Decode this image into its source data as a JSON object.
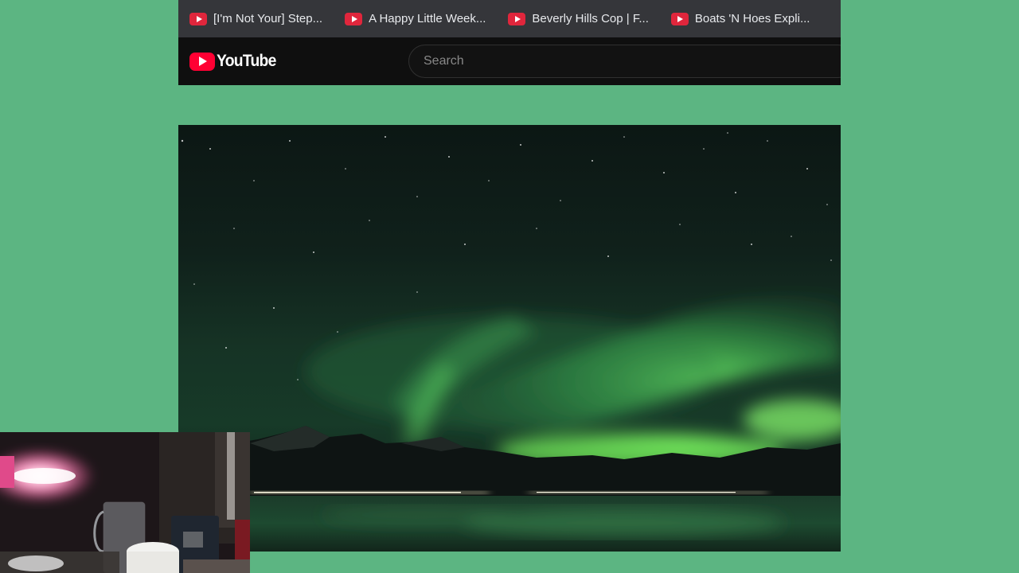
{
  "bookmarks": [
    {
      "label": "[I'm Not Your] Step...",
      "icon": "youtube-icon"
    },
    {
      "label": "A Happy Little Week...",
      "icon": "youtube-icon"
    },
    {
      "label": "Beverly Hills Cop | F...",
      "icon": "youtube-icon"
    },
    {
      "label": "Boats 'N Hoes Expli...",
      "icon": "youtube-icon"
    }
  ],
  "masthead": {
    "logo_text": "YouTube",
    "search_placeholder": "Search"
  },
  "colors": {
    "page_background": "#5cb582",
    "bookmark_bar": "#35363a",
    "masthead": "#0f0f0f",
    "youtube_red": "#ff0033",
    "aurora_green": "#5fe05a"
  },
  "video": {
    "scene": "aurora-over-fjord"
  },
  "webcam": {
    "scene": "desk-with-lamp-and-mug"
  }
}
